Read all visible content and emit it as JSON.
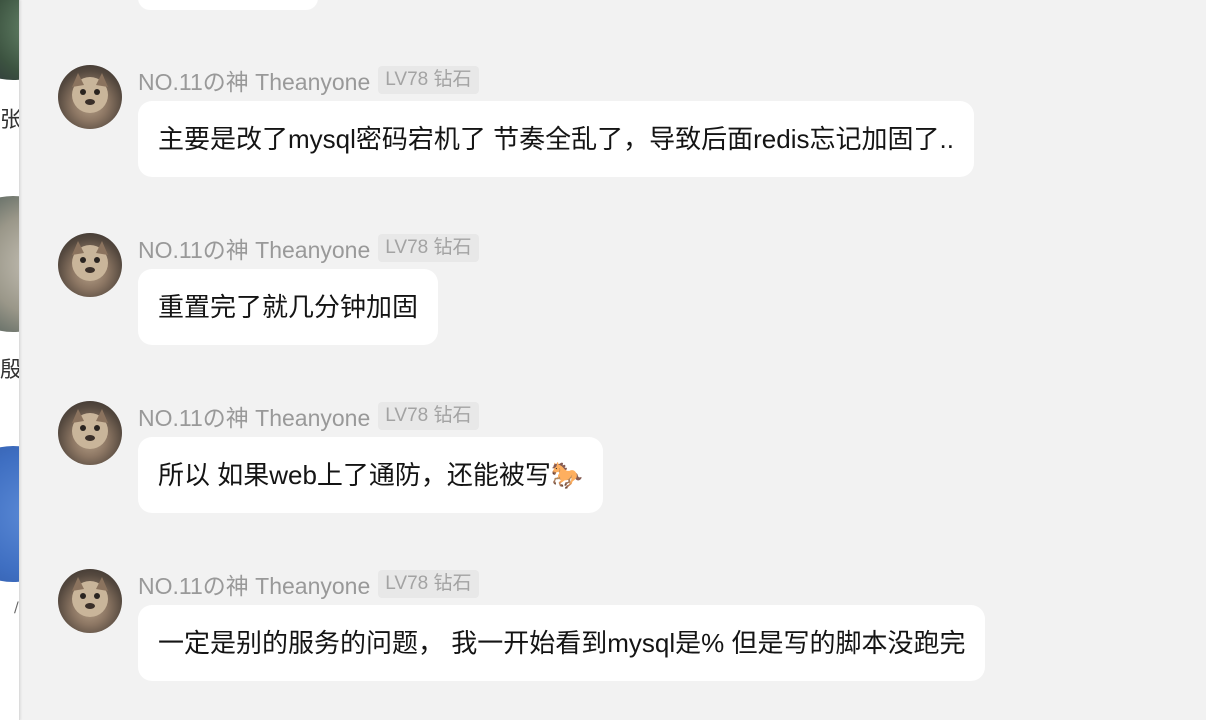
{
  "sidebar": {
    "items": [
      {
        "label": "张!"
      },
      {
        "label": "殷!"
      },
      {
        "label": "/"
      }
    ]
  },
  "messages": [
    {
      "nickname": "NO.11の神 Theanyone",
      "badge": "LV78 钻石",
      "text": "主要是改了mysql密码宕机了 节奏全乱了，导致后面redis忘记加固了.."
    },
    {
      "nickname": "NO.11の神 Theanyone",
      "badge": "LV78 钻石",
      "text": "重置完了就几分钟加固"
    },
    {
      "nickname": "NO.11の神 Theanyone",
      "badge": "LV78 钻石",
      "text": "所以 如果web上了通防，还能被写🐎"
    },
    {
      "nickname": "NO.11の神 Theanyone",
      "badge": "LV78 钻石",
      "text": "一定是别的服务的问题， 我一开始看到mysql是% 但是写的脚本没跑完"
    }
  ],
  "colors": {
    "background": "#f2f2f2",
    "bubble": "#ffffff",
    "nickname": "#999999",
    "badge_bg": "#e8e8e8"
  }
}
